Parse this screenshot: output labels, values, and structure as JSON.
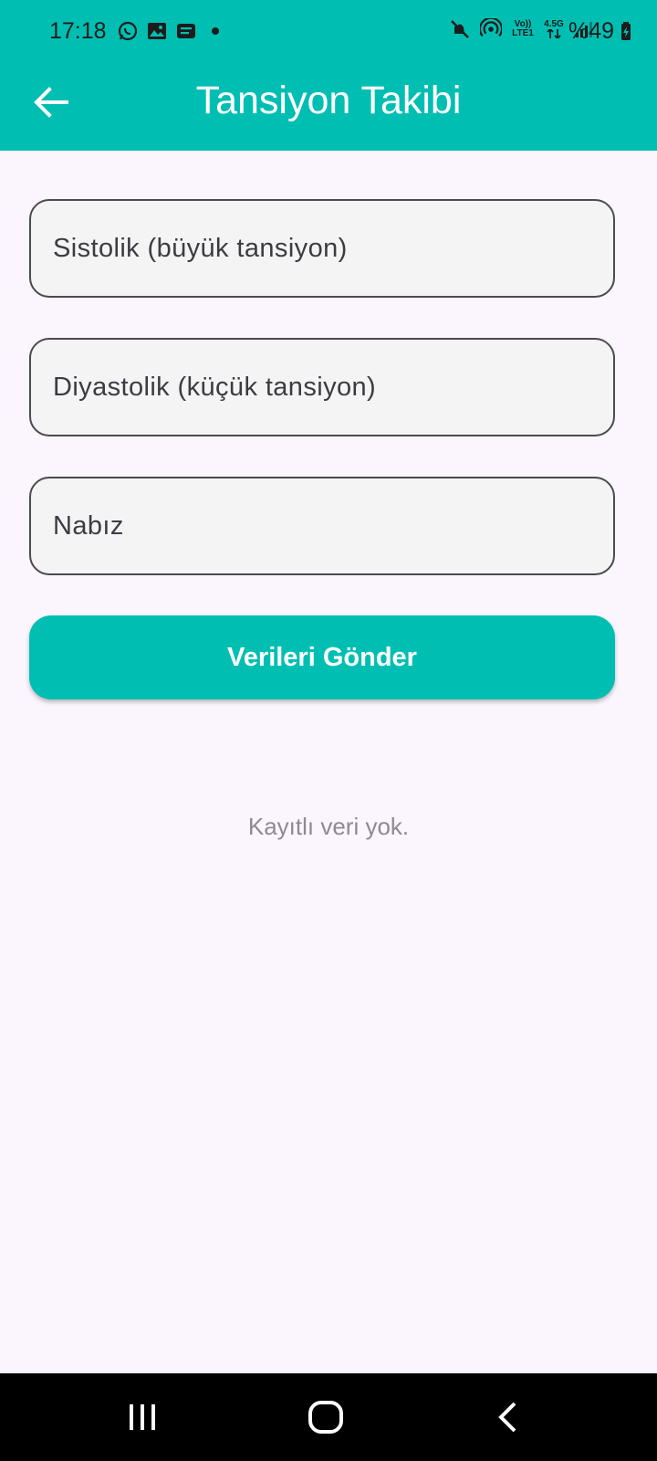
{
  "status_bar": {
    "time": "17:18",
    "battery": "%49",
    "network_top": "Vo))",
    "network_bottom": "LTE1",
    "network_gen": "4.5G"
  },
  "app_bar": {
    "title": "Tansiyon Takibi",
    "back_icon": "arrow-left-icon"
  },
  "form": {
    "systolic_placeholder": "Sistolik (büyük tansiyon)",
    "diastolic_placeholder": "Diyastolik (küçük tansiyon)",
    "pulse_placeholder": "Nabız",
    "systolic_value": "",
    "diastolic_value": "",
    "pulse_value": "",
    "submit_label": "Verileri Gönder"
  },
  "records": {
    "empty_message": "Kayıtlı veri yok."
  },
  "nav_bar": {
    "recent_icon": "recent-apps-icon",
    "home_icon": "home-icon",
    "back_icon": "back-chevron-icon"
  },
  "colors": {
    "accent": "#00bfb2",
    "background": "#fbf5fd",
    "field_fill": "#f4f4f4",
    "empty_text": "#8d8b90"
  }
}
